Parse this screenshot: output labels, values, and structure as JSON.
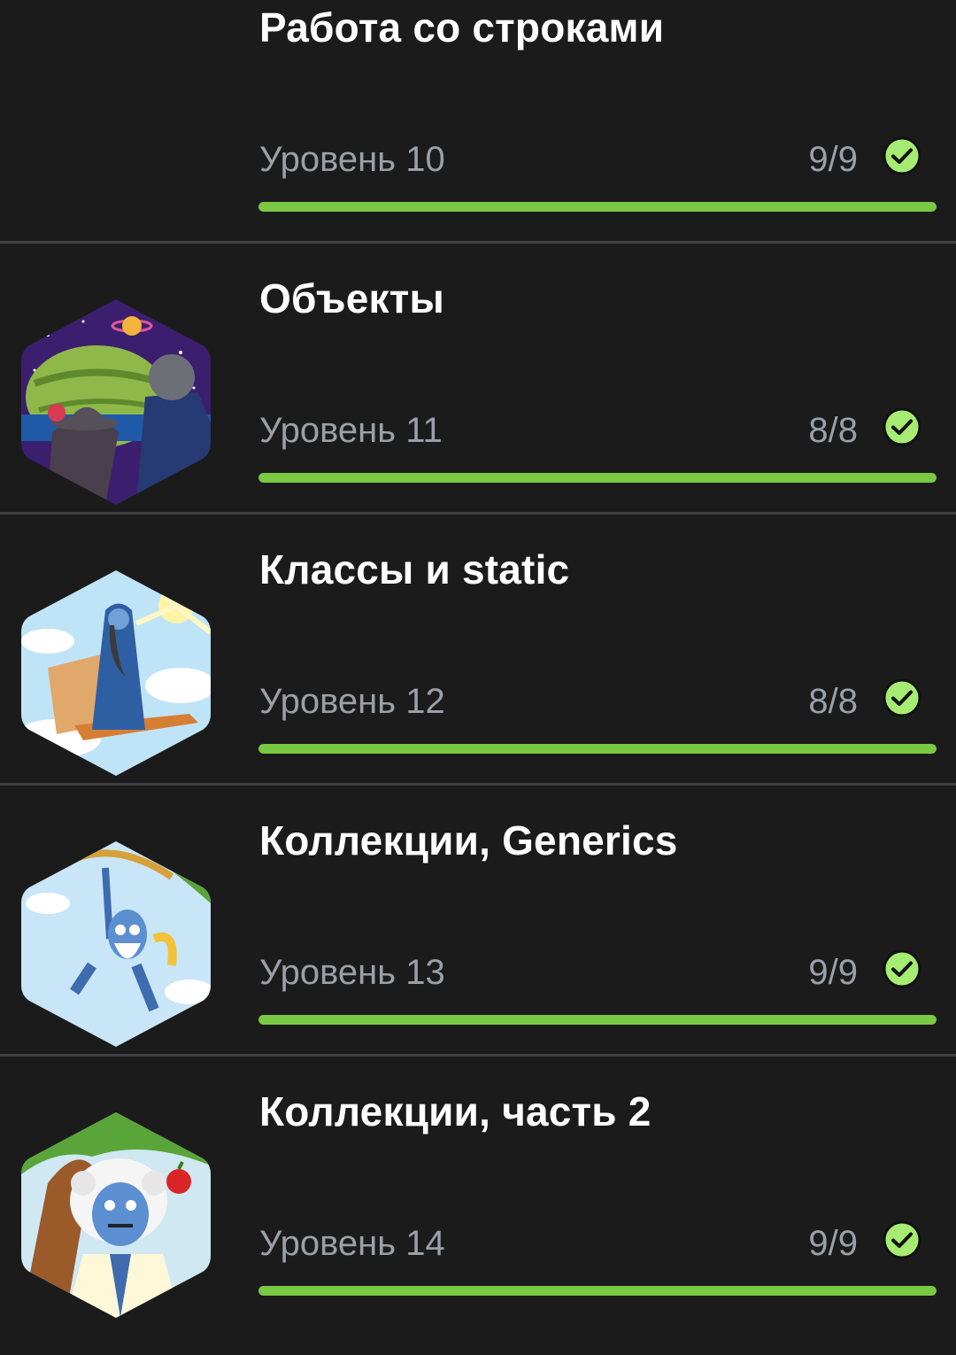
{
  "colors": {
    "background": "#1b1b1c",
    "title": "#ffffff",
    "secondary_text": "#9aa0a6",
    "progress_fill": "#7ac943",
    "progress_track": "#3a3a3a",
    "divider": "#3f4145",
    "check_fill": "#a6ec73"
  },
  "lessons": [
    {
      "title": "Работа со строками",
      "level": "Уровень 10",
      "count": "9/9",
      "progress": 1.0,
      "completed": true,
      "status_icon": "check-circle-icon",
      "thumbnail": "none"
    },
    {
      "title": "Объекты",
      "level": "Уровень 11",
      "count": "8/8",
      "progress": 1.0,
      "completed": true,
      "status_icon": "check-circle-icon",
      "thumbnail": "space-observers-illustration"
    },
    {
      "title": "Классы и static",
      "level": "Уровень 12",
      "count": "8/8",
      "progress": 1.0,
      "completed": true,
      "status_icon": "check-circle-icon",
      "thumbnail": "wizard-flying-carpet-illustration"
    },
    {
      "title": "Коллекции, Generics",
      "level": "Уровень 13",
      "count": "9/9",
      "progress": 1.0,
      "completed": true,
      "status_icon": "check-circle-icon",
      "thumbnail": "robot-on-vine-illustration"
    },
    {
      "title": "Коллекции, часть 2",
      "level": "Уровень 14",
      "count": "9/9",
      "progress": 1.0,
      "completed": true,
      "status_icon": "check-circle-icon",
      "thumbnail": "robot-under-apple-tree-illustration"
    }
  ]
}
